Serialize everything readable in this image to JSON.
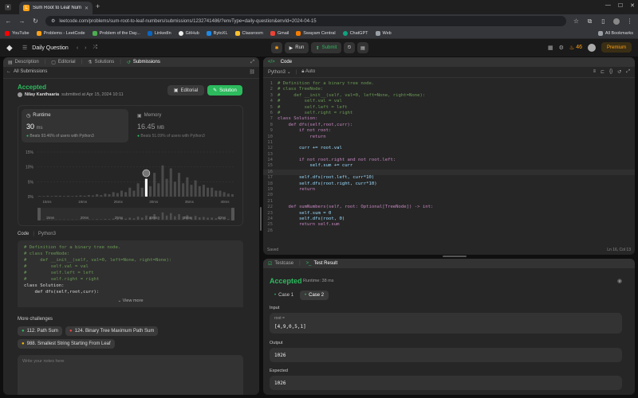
{
  "browser": {
    "tab_title": "Sum Root to Leaf Numbers - Lee",
    "url": "leetcode.com/problems/sum-root-to-leaf-numbers/submissions/1232741486/?envType=daily-question&envId=2024-04-15",
    "bookmarks": [
      "YouTube",
      "Problems - LeetCode",
      "Problem of the Day...",
      "LinkedIn",
      "GitHub",
      "BytoXL",
      "Classroom",
      "Gmail",
      "Swayam Central",
      "ChatGPT",
      "Web"
    ],
    "all_bookmarks": "All Bookmarks"
  },
  "nav": {
    "title": "Daily Question",
    "run": "Run",
    "submit": "Submit",
    "streak": "46",
    "premium": "Premium"
  },
  "left": {
    "tabs": [
      "Description",
      "Editorial",
      "Solutions",
      "Submissions"
    ],
    "all_submissions": "All Submissions",
    "status": "Accepted",
    "user": "Nilay Kanthaaria",
    "submitted": "submitted at Apr 15, 2024 10:11",
    "editorial_btn": "Editorial",
    "solution_btn": "Solution",
    "runtime_label": "Runtime",
    "runtime_value": "30",
    "runtime_unit": "ms",
    "runtime_beats": "Beats 93.46% of users with Python3",
    "memory_label": "Memory",
    "memory_value": "16.45",
    "memory_unit": "MB",
    "memory_beats": "Beats 51.09% of users with Python3",
    "code_label": "Code",
    "lang": "Python3",
    "view_more": "View more",
    "more_challenges": "More challenges",
    "challenges": [
      "112. Path Sum",
      "124. Binary Tree Maximum Path Sum",
      "988. Smallest String Starting From Leaf"
    ],
    "notes_placeholder": "Write your notes here"
  },
  "chart_data": {
    "type": "bar",
    "yticks": [
      "15%",
      "10%",
      "5%",
      "0%"
    ],
    "xticks": [
      "15ms",
      "19ms",
      "25ms",
      "30ms",
      "35ms",
      "40ms"
    ],
    "mini_xticks": [
      "15ms",
      "20ms",
      "25ms",
      "30ms",
      "35ms",
      "40ms"
    ],
    "ylim": [
      0,
      15
    ],
    "values": [
      0.2,
      0.2,
      0.3,
      0.2,
      0.3,
      0.3,
      0.2,
      0.3,
      0.2,
      0.3,
      0.4,
      0.3,
      0.5,
      0.4,
      0.8,
      0.5,
      1.0,
      0.8,
      1.5,
      1.2,
      2.0,
      1.5,
      3.0,
      2.0,
      4.5,
      3.0,
      6.0,
      3.5,
      8.0,
      4.5,
      10.5,
      6.0,
      9.5,
      5.0,
      8.0,
      4.5,
      6.5,
      4.0,
      5.5,
      3.5,
      4.0,
      3.0,
      3.0,
      2.0,
      2.0,
      1.5,
      1.0,
      0.8
    ],
    "highlight_index": 26
  },
  "code": {
    "tab": "Code",
    "lang": "Python3",
    "auto": "Auto",
    "lines": [
      "# Definition for a binary tree node.",
      "# class TreeNode:",
      "#     def __init__(self, val=0, left=None, right=None):",
      "#         self.val = val",
      "#         self.left = left",
      "#         self.right = right",
      "class Solution:",
      "    def dfs(self,root,curr):",
      "        if not root:",
      "            return",
      "",
      "        curr += root.val",
      "",
      "        if not root.right and not root.left:",
      "            self.sum += curr",
      "",
      "        self.dfs(root.left, curr*10)",
      "        self.dfs(root.right, curr*10)",
      "        return",
      "",
      "",
      "    def sumNumbers(self, root: Optional[TreeNode]) -> int:",
      "        self.sum = 0",
      "        self.dfs(root, 0)",
      "        return self.sum",
      ""
    ],
    "saved": "Saved",
    "position": "Ln 16, Col 13"
  },
  "result": {
    "tabs": [
      "Testcase",
      "Test Result"
    ],
    "status": "Accepted",
    "runtime": "Runtime: 38 ms",
    "cases": [
      "Case 1",
      "Case 2"
    ],
    "input_label": "Input",
    "input_var": "root =",
    "input_value": "[4,9,0,5,1]",
    "output_label": "Output",
    "output_value": "1026",
    "expected_label": "Expected",
    "expected_value": "1026"
  },
  "colors": {
    "accent_green": "#2cbb5d",
    "accent_orange": "#ffa116",
    "bg_panel": "#262626"
  }
}
